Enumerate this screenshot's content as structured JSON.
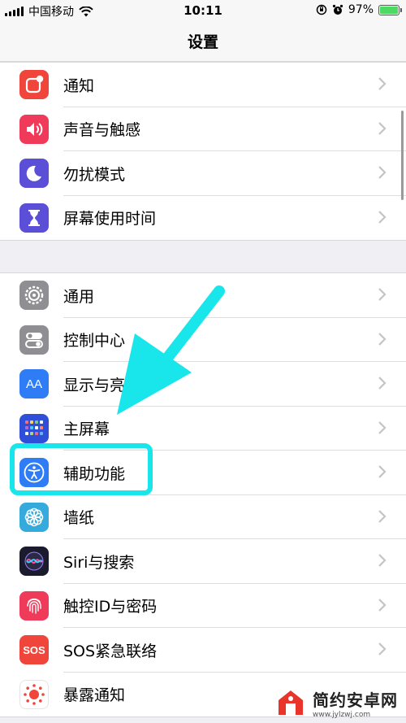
{
  "status_bar": {
    "carrier": "中国移动",
    "time": "10:11",
    "battery_percent": "97%"
  },
  "nav": {
    "title": "设置"
  },
  "groups": [
    {
      "items": [
        {
          "label": "通知",
          "icon": "notifications-icon",
          "color": "#f0453a"
        },
        {
          "label": "声音与触感",
          "icon": "sounds-icon",
          "color": "#f03a59"
        },
        {
          "label": "勿扰模式",
          "icon": "do-not-disturb-icon",
          "color": "#5a4fd6"
        },
        {
          "label": "屏幕使用时间",
          "icon": "screen-time-icon",
          "color": "#5a4fd6"
        }
      ]
    },
    {
      "items": [
        {
          "label": "通用",
          "icon": "gear-icon",
          "color": "#8e8e93"
        },
        {
          "label": "控制中心",
          "icon": "control-center-icon",
          "color": "#8e8e93"
        },
        {
          "label": "显示与亮",
          "icon": "display-brightness-icon",
          "color": "#2f7df6"
        },
        {
          "label": "主屏幕",
          "icon": "home-screen-icon",
          "color": "#2f5fe0"
        },
        {
          "label": "辅助功能",
          "icon": "accessibility-icon",
          "color": "#2f7df6"
        },
        {
          "label": "墙纸",
          "icon": "wallpaper-icon",
          "color": "#35aadc"
        },
        {
          "label": "Siri与搜索",
          "icon": "siri-icon",
          "color": "#1b1b2e"
        },
        {
          "label": "触控ID与密码",
          "icon": "fingerprint-icon",
          "color": "#f03a59"
        },
        {
          "label": "SOS紧急联络",
          "icon": "sos-icon",
          "color": "#f0453a"
        },
        {
          "label": "暴露通知",
          "icon": "exposure-notifications-icon",
          "color": "#ffffff"
        }
      ]
    }
  ],
  "icon_text": {
    "aa": "AA",
    "sos": "SOS"
  },
  "annotation": {
    "highlight_color": "#19e6ea",
    "arrow_color": "#19e6ea"
  },
  "watermark": {
    "name": "简约安卓网",
    "url": "www.jylzwj.com"
  }
}
